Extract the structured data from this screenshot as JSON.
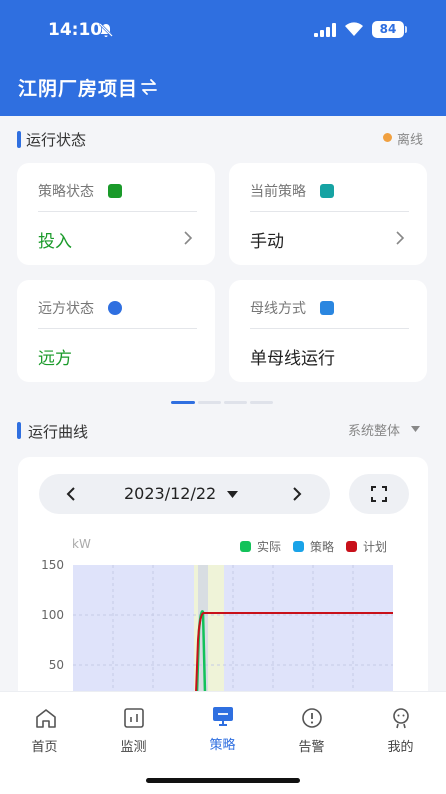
{
  "status_bar": {
    "time": "14:10",
    "battery": "84"
  },
  "header": {
    "project_name": "江阴厂房项目"
  },
  "run_status": {
    "title": "运行状态",
    "connection": "离线",
    "cards": [
      {
        "label": "策略状态",
        "value": "投入",
        "value_color": "#1a9a2a",
        "icon_color": "#1a9a2a"
      },
      {
        "label": "当前策略",
        "value": "手动",
        "value_color": "#222222",
        "icon_color": "#16a3a3"
      },
      {
        "label": "远方状态",
        "value": "远方",
        "value_color": "#1a9a2a",
        "icon_color": "#2f6fe0"
      },
      {
        "label": "母线方式",
        "value": "单母线运行",
        "value_color": "#222222",
        "icon_color": "#2a86e0"
      }
    ],
    "pager": {
      "pages": 4,
      "active": 0
    }
  },
  "curve": {
    "title": "运行曲线",
    "scope_selector": "系统整体",
    "date": "2023/12/22",
    "unit": "kW"
  },
  "chart_data": {
    "type": "line",
    "ylabel": "kW",
    "ylim": [
      40,
      150
    ],
    "yticks": [
      150,
      100,
      50
    ],
    "series": [
      {
        "name": "实际",
        "color": "#13c25a"
      },
      {
        "name": "策略",
        "color": "#1aa3e8"
      },
      {
        "name": "计划",
        "color": "#c8101a",
        "level": 102
      }
    ]
  },
  "tabbar": {
    "items": [
      {
        "label": "首页",
        "icon": "home-icon"
      },
      {
        "label": "监测",
        "icon": "monitor-icon"
      },
      {
        "label": "策略",
        "icon": "strategy-icon",
        "active": true
      },
      {
        "label": "告警",
        "icon": "alarm-icon"
      },
      {
        "label": "我的",
        "icon": "profile-icon"
      }
    ]
  },
  "colors": {
    "brand": "#2f6fe0",
    "offline": "#f0a040",
    "plot_bg": "#dfe3fa"
  }
}
